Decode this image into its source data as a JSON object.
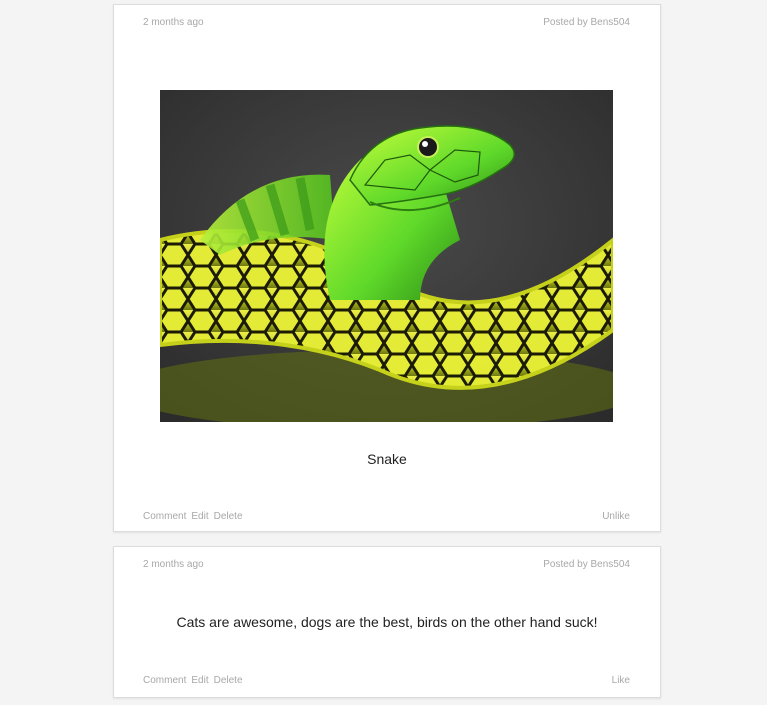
{
  "posts": [
    {
      "time": "2 months ago",
      "author": "Posted by Bens504",
      "image_subject": "green snake",
      "caption": "Snake",
      "actions": {
        "comment": "Comment",
        "edit": "Edit",
        "delete": "Delete"
      },
      "like": "Unlike"
    },
    {
      "time": "2 months ago",
      "author": "Posted by Bens504",
      "caption": "Cats are awesome, dogs are the best, birds on the other hand suck!",
      "actions": {
        "comment": "Comment",
        "edit": "Edit",
        "delete": "Delete"
      },
      "like": "Like"
    }
  ],
  "colors": {
    "page_bg": "#f4f4f4",
    "card_bg": "#ffffff",
    "meta_text": "#a8a8a8",
    "body_text": "#222222"
  }
}
